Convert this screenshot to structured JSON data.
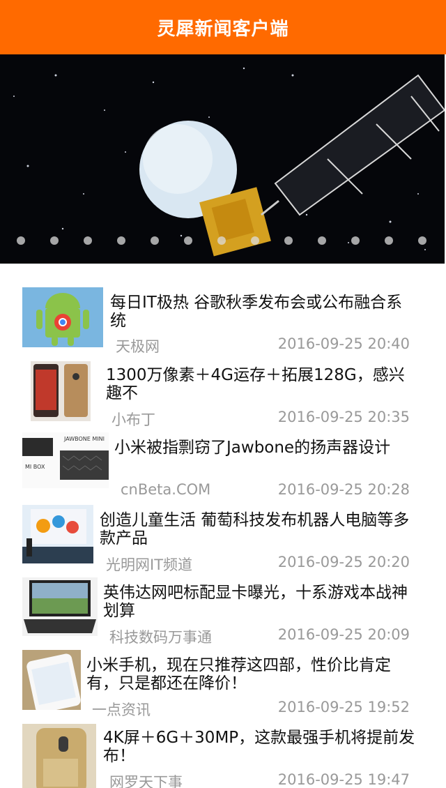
{
  "header": {
    "title": "灵犀新闻客户端"
  },
  "banner": {
    "image": "satellite-over-planet",
    "dot_count": 13
  },
  "news": [
    {
      "title": "每日IT极热 谷歌秋季发布会或公布融合系统",
      "source": "天极网",
      "time": "2016-09-25 20:40",
      "thumb": "android-chrome-logo"
    },
    {
      "title": "1300万像素＋4G运存＋拓展128G，感兴趣不",
      "source": "小布丁",
      "time": "2016-09-25 20:35",
      "thumb": "smartphone"
    },
    {
      "title": "小米被指剽窃了Jawbone的扬声器设计",
      "source": "cnBeta.COM",
      "time": "2016-09-25 20:28",
      "thumb": "speakers",
      "thumb_labels": [
        "JAWBONE MINI",
        "MI BOX"
      ]
    },
    {
      "title": "创造儿童生活 葡萄科技发布机器人电脑等多款产品",
      "source": "光明网IT频道",
      "time": "2016-09-25 20:20",
      "thumb": "stage-presentation"
    },
    {
      "title": "英伟达网吧标配显卡曝光，十系游戏本战神划算",
      "source": "科技数码万事通",
      "time": "2016-09-25 20:09",
      "thumb": "laptop"
    },
    {
      "title": "小米手机，现在只推荐这四部，性价比肯定有，只是都还在降价！",
      "source": "一点资讯",
      "time": "2016-09-25 19:52",
      "thumb": "white-phone"
    },
    {
      "title": "4K屏＋6G＋30MP，这款最强手机将提前发布！",
      "source": "网罗天下事",
      "time": "2016-09-25 19:47",
      "thumb": "gold-phone"
    }
  ]
}
